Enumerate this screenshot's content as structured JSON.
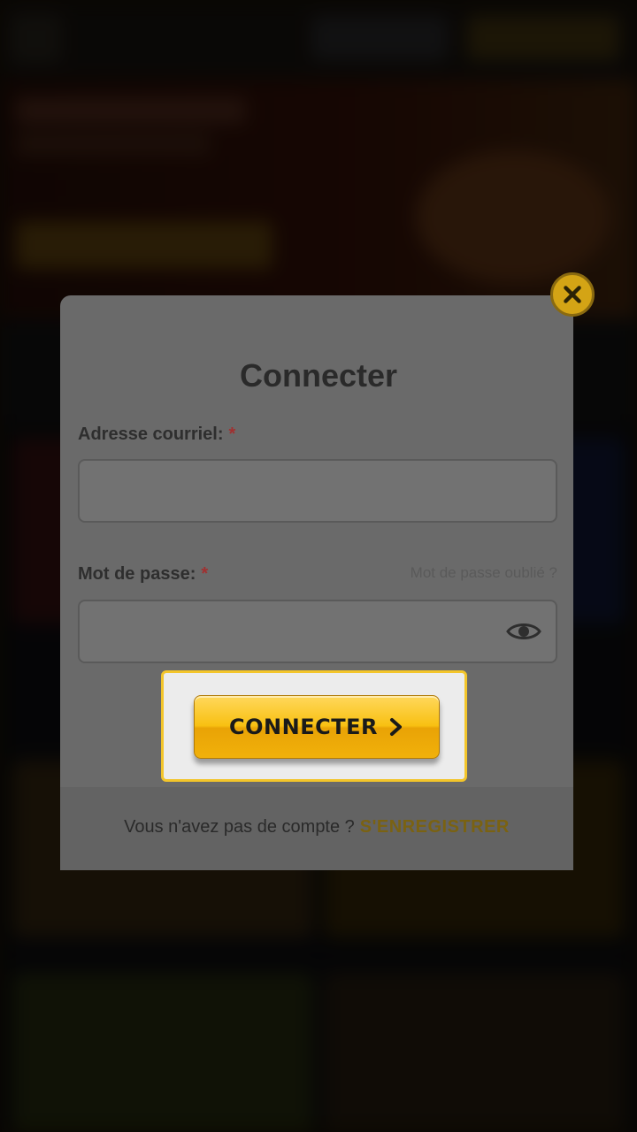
{
  "modal": {
    "title": "Connecter",
    "email_label": "Adresse courriel:",
    "required_mark": "*",
    "email_value": "",
    "password_label": "Mot de passe:",
    "password_value": "",
    "forgot_password": "Mot de passe oublié ?",
    "submit_label": "CONNECTER",
    "no_account_text": "Vous n'avez pas de compte ?",
    "register_link": "S'ENREGISTRER",
    "icons": [
      "close-icon",
      "eye-icon",
      "chevron-right-icon"
    ]
  },
  "colors": {
    "accent": "#f8c012",
    "highlight_border": "#f3c52a",
    "required": "#a13030"
  }
}
